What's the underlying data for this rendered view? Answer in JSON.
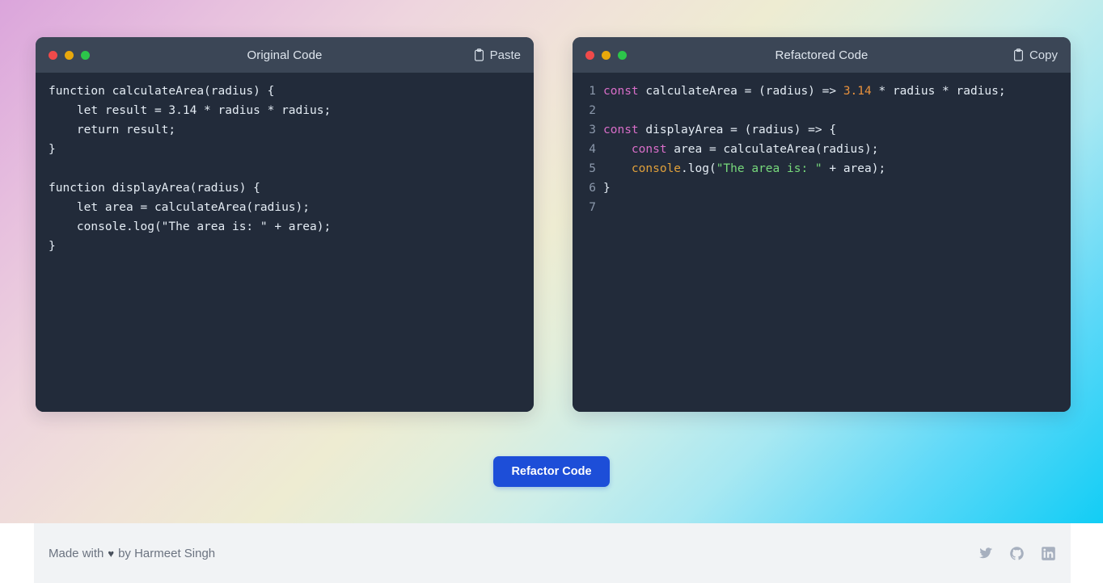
{
  "theme": {
    "bg_gradient_start": "#dba5dc",
    "bg_gradient_mid": "#eeecd2",
    "bg_gradient_end": "#12cdf5",
    "panel_bg": "#222b3a",
    "panel_header_bg": "#3b4656",
    "accent_button": "#1d4ed8",
    "footer_bg": "#f1f3f5",
    "keyword_color": "#d96ec9",
    "number_color": "#e8913c",
    "string_color": "#77d97b",
    "function_color": "#e0a03a",
    "line_number_color": "#8b98ab"
  },
  "left_panel": {
    "title": "Original Code",
    "action_label": "Paste",
    "action_icon": "clipboard-icon",
    "traffic_lights": [
      "#f04a4a",
      "#e8a80c",
      "#2cc54a"
    ],
    "code": "function calculateArea(radius) {\n    let result = 3.14 * radius * radius;\n    return result;\n}\n\nfunction displayArea(radius) {\n    let area = calculateArea(radius);\n    console.log(\"The area is: \" + area);\n}"
  },
  "right_panel": {
    "title": "Refactored Code",
    "action_label": "Copy",
    "action_icon": "clipboard-icon",
    "traffic_lights": [
      "#f04a4a",
      "#e8a80c",
      "#2cc54a"
    ],
    "lines": [
      {
        "n": "1",
        "tokens": [
          {
            "t": "const",
            "c": "tok-kw"
          },
          {
            "t": " calculateArea = (radius) => ",
            "c": "tok-pl"
          },
          {
            "t": "3.14",
            "c": "tok-num"
          },
          {
            "t": " * radius * radius;",
            "c": "tok-pl"
          }
        ]
      },
      {
        "n": "2",
        "tokens": []
      },
      {
        "n": "3",
        "tokens": [
          {
            "t": "const",
            "c": "tok-kw"
          },
          {
            "t": " displayArea = (radius) => {",
            "c": "tok-pl"
          }
        ]
      },
      {
        "n": "4",
        "tokens": [
          {
            "t": "    ",
            "c": "tok-pl"
          },
          {
            "t": "const",
            "c": "tok-kw"
          },
          {
            "t": " area = calculateArea(radius);",
            "c": "tok-pl"
          }
        ]
      },
      {
        "n": "5",
        "tokens": [
          {
            "t": "    ",
            "c": "tok-pl"
          },
          {
            "t": "console",
            "c": "tok-fn"
          },
          {
            "t": ".log(",
            "c": "tok-pl"
          },
          {
            "t": "\"The area is: \"",
            "c": "tok-str"
          },
          {
            "t": " + area);",
            "c": "tok-pl"
          }
        ]
      },
      {
        "n": "6",
        "tokens": [
          {
            "t": "}",
            "c": "tok-pl"
          }
        ]
      },
      {
        "n": "7",
        "tokens": []
      }
    ]
  },
  "actions": {
    "refactor_label": "Refactor Code"
  },
  "footer": {
    "made_with": "Made with",
    "heart": "♥",
    "by": "by Harmeet Singh",
    "socials": [
      {
        "name": "twitter-icon"
      },
      {
        "name": "github-icon"
      },
      {
        "name": "linkedin-icon"
      }
    ]
  }
}
